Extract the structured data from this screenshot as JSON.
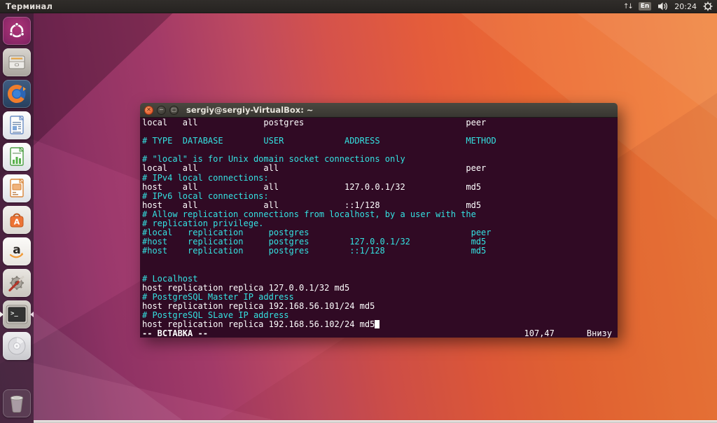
{
  "panel": {
    "app_title": "Терминал",
    "tray": {
      "network_icon": "network-arrows-icon",
      "keyboard_layout": "En",
      "volume_icon": "speaker-icon",
      "clock": "20:24",
      "session_icon": "session-gear-icon",
      "arrows_glyph": "↑↓"
    }
  },
  "launcher": {
    "items": [
      {
        "name": "dash-home",
        "icon": "ubuntu-logo-icon"
      },
      {
        "name": "files",
        "icon": "file-cabinet-icon"
      },
      {
        "name": "firefox",
        "icon": "firefox-icon"
      },
      {
        "name": "libreoffice-writer",
        "icon": "writer-document-icon"
      },
      {
        "name": "libreoffice-calc",
        "icon": "calc-spreadsheet-icon"
      },
      {
        "name": "libreoffice-impress",
        "icon": "impress-presentation-icon"
      },
      {
        "name": "ubuntu-software-center",
        "icon": "software-center-bag-icon"
      },
      {
        "name": "amazon",
        "icon": "amazon-icon"
      },
      {
        "name": "system-settings",
        "icon": "settings-gear-icon"
      },
      {
        "name": "terminal",
        "icon": "terminal-icon",
        "focused": true
      },
      {
        "name": "disks",
        "icon": "cd-disc-icon"
      },
      {
        "name": "trash",
        "icon": "trash-icon"
      }
    ],
    "software_center_letter": "A",
    "amazon_letter": "a",
    "terminal_prompt": ">_"
  },
  "terminal_window": {
    "title": "sergiy@sergiy-VirtualBox: ~",
    "window_buttons": [
      "close",
      "minimize",
      "maximize"
    ],
    "lines": [
      {
        "t": "local   all             postgres                                peer",
        "c": "p"
      },
      {
        "t": "",
        "c": "p"
      },
      {
        "t": "# TYPE  DATABASE        USER            ADDRESS                 METHOD",
        "c": "c"
      },
      {
        "t": "",
        "c": "p"
      },
      {
        "t": "# \"local\" is for Unix domain socket connections only",
        "c": "c"
      },
      {
        "t": "local   all             all                                     peer",
        "c": "p"
      },
      {
        "t": "# IPv4 local connections:",
        "c": "c"
      },
      {
        "t": "host    all             all             127.0.0.1/32            md5",
        "c": "p"
      },
      {
        "t": "# IPv6 local connections:",
        "c": "c"
      },
      {
        "t": "host    all             all             ::1/128                 md5",
        "c": "p"
      },
      {
        "t": "# Allow replication connections from localhost, by a user with the",
        "c": "c"
      },
      {
        "t": "# replication privilege.",
        "c": "c"
      },
      {
        "t": "#local   replication     postgres                                peer",
        "c": "c"
      },
      {
        "t": "#host    replication     postgres        127.0.0.1/32            md5",
        "c": "c"
      },
      {
        "t": "#host    replication     postgres        ::1/128                 md5",
        "c": "c"
      },
      {
        "t": "",
        "c": "p"
      },
      {
        "t": "",
        "c": "p"
      },
      {
        "t": "# Localhost",
        "c": "c"
      },
      {
        "t": "host replication replica 127.0.0.1/32 md5",
        "c": "p"
      },
      {
        "t": "# PostgreSQL Master IP address",
        "c": "c"
      },
      {
        "t": "host replication replica 192.168.56.101/24 md5",
        "c": "p"
      },
      {
        "t": "# PostgreSQL SLave IP address",
        "c": "c"
      },
      {
        "t": "host replication replica 192.168.56.102/24 md5",
        "c": "p",
        "cursor": true
      }
    ],
    "status": {
      "mode": "-- ВСТАВКА --",
      "ruler": "107,47",
      "position": "Внизу"
    }
  },
  "colors": {
    "terminal_bg": "#300a24",
    "terminal_fg": "#ffffff",
    "comment_cyan": "#34e2e2",
    "panel_bg": "#2c2927",
    "wallpaper_purple": "#7c2a68",
    "wallpaper_orange": "#e8613c",
    "close_button": "#df4b1e"
  }
}
